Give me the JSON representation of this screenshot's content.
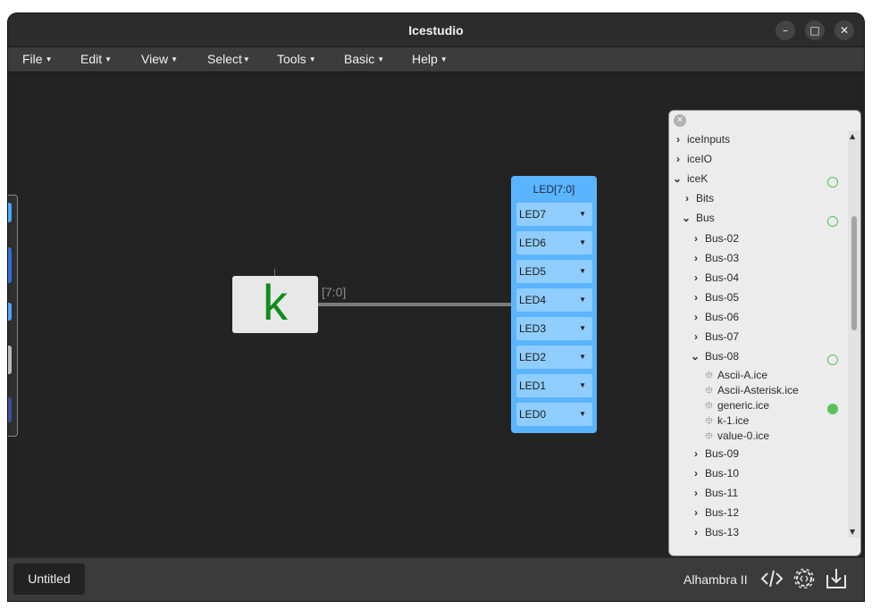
{
  "window": {
    "title": "Icestudio",
    "controls": {
      "minimize": "–",
      "maximize": "□",
      "close": "✕"
    }
  },
  "menubar": {
    "items": [
      {
        "label": "File"
      },
      {
        "label": "Edit"
      },
      {
        "label": "View"
      },
      {
        "label": "Select"
      },
      {
        "label": "Tools"
      },
      {
        "label": "Basic"
      },
      {
        "label": "Help"
      }
    ]
  },
  "canvas": {
    "constant_block": {
      "symbol": "k",
      "color": "#128c1b"
    },
    "wire_label": "[7:0]",
    "output_block": {
      "title": "LED[7:0]",
      "color": "#5bb4ff",
      "pins": [
        "LED7",
        "LED6",
        "LED5",
        "LED4",
        "LED3",
        "LED2",
        "LED1",
        "LED0"
      ]
    }
  },
  "collections_panel": {
    "close_icon": "x-icon",
    "tree": [
      {
        "label": "iceInputs",
        "expanded": false,
        "type": "folder",
        "status": "none"
      },
      {
        "label": "iceIO",
        "expanded": false,
        "type": "folder",
        "status": "none"
      },
      {
        "label": "iceK",
        "expanded": true,
        "type": "folder",
        "status": "hollow"
      },
      {
        "label": "Bits",
        "expanded": false,
        "type": "folder",
        "status": "none"
      },
      {
        "label": "Bus",
        "expanded": true,
        "type": "folder",
        "status": "hollow"
      },
      {
        "label": "Bus-02",
        "expanded": false,
        "type": "folder",
        "status": "none"
      },
      {
        "label": "Bus-03",
        "expanded": false,
        "type": "folder",
        "status": "none"
      },
      {
        "label": "Bus-04",
        "expanded": false,
        "type": "folder",
        "status": "none"
      },
      {
        "label": "Bus-05",
        "expanded": false,
        "type": "folder",
        "status": "none"
      },
      {
        "label": "Bus-06",
        "expanded": false,
        "type": "folder",
        "status": "none"
      },
      {
        "label": "Bus-07",
        "expanded": false,
        "type": "folder",
        "status": "none"
      },
      {
        "label": "Bus-08",
        "expanded": true,
        "type": "folder",
        "status": "hollow"
      },
      {
        "label": "Ascii-A.ice",
        "type": "file",
        "status": "none"
      },
      {
        "label": "Ascii-Asterisk.ice",
        "type": "file",
        "status": "none"
      },
      {
        "label": "generic.ice",
        "type": "file",
        "status": "filled"
      },
      {
        "label": "k-1.ice",
        "type": "file",
        "status": "none"
      },
      {
        "label": "value-0.ice",
        "type": "file",
        "status": "none"
      },
      {
        "label": "Bus-09",
        "expanded": false,
        "type": "folder",
        "status": "none"
      },
      {
        "label": "Bus-10",
        "expanded": false,
        "type": "folder",
        "status": "none"
      },
      {
        "label": "Bus-11",
        "expanded": false,
        "type": "folder",
        "status": "none"
      },
      {
        "label": "Bus-12",
        "expanded": false,
        "type": "folder",
        "status": "none"
      },
      {
        "label": "Bus-13",
        "expanded": false,
        "type": "folder",
        "status": "none"
      }
    ]
  },
  "bottombar": {
    "file_tab": "Untitled",
    "board": "Alhambra II",
    "icons": [
      "code-icon",
      "settings-gear-icon",
      "download-icon"
    ]
  },
  "colors": {
    "accent_blue": "#5bb4ff",
    "status_green": "#5bc25b"
  }
}
